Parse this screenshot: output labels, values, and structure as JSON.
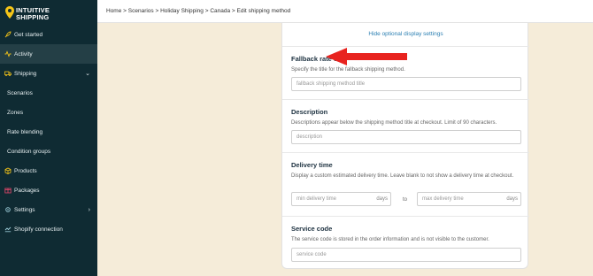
{
  "brand": {
    "line1": "INTUITIVE",
    "line2": "SHIPPING"
  },
  "breadcrumb": [
    "Home",
    "Scenarios",
    "Holiday Shipping",
    "Canada",
    "Edit shipping method"
  ],
  "breadcrumb_sep": ">",
  "sidebar": {
    "items": [
      {
        "label": "Get started",
        "icon": "rocket-icon"
      },
      {
        "label": "Activity",
        "icon": "activity-icon"
      },
      {
        "label": "Shipping",
        "icon": "truck-icon",
        "expanded": true
      },
      {
        "label": "Scenarios"
      },
      {
        "label": "Zones"
      },
      {
        "label": "Rate blending"
      },
      {
        "label": "Condition groups"
      },
      {
        "label": "Products",
        "icon": "box-icon"
      },
      {
        "label": "Packages",
        "icon": "package-icon"
      },
      {
        "label": "Settings",
        "icon": "gear-icon"
      },
      {
        "label": "Shopify connection",
        "icon": "link-icon"
      }
    ]
  },
  "form": {
    "hide_link": "Hide optional display settings",
    "fallback": {
      "title": "Fallback rate title",
      "desc": "Specify the title for the fallback shipping method.",
      "placeholder": "fallback shipping method title"
    },
    "description": {
      "title": "Description",
      "desc": "Descriptions appear below the shipping method title at checkout. Limit of 90 characters.",
      "placeholder": "description"
    },
    "delivery": {
      "title": "Delivery time",
      "desc": "Display a custom estimated delivery time. Leave blank to not show a delivery time at checkout.",
      "min_placeholder": "min delivery time",
      "max_placeholder": "max delivery time",
      "unit": "days",
      "to": "to"
    },
    "service": {
      "title": "Service code",
      "desc": "The service code is stored in the order information and is not visible to the customer.",
      "placeholder": "service code"
    }
  },
  "colors": {
    "sidebar": "#0f2b33",
    "accent": "#f5c518",
    "link": "#2b7fb2",
    "arrow": "#e8231f",
    "background": "#f5ecd9"
  }
}
